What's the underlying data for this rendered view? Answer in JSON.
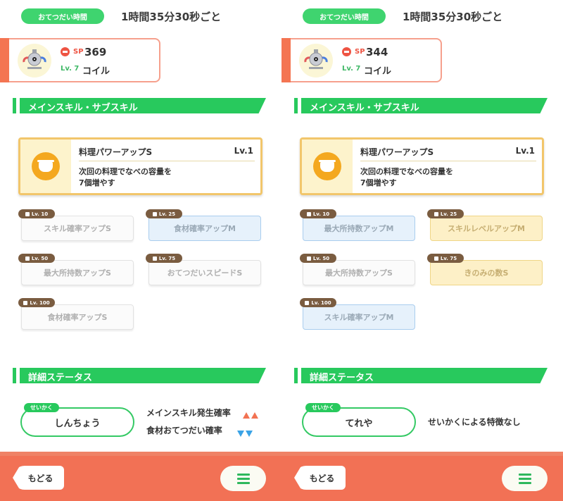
{
  "colors": {
    "accent_green": "#28c95d",
    "accent_orange": "#f27155",
    "sp_red": "#ee5443",
    "skill_gold": "#f2c66b",
    "increase_red": "#f27252",
    "decrease_blue": "#3aa3e6"
  },
  "panels": [
    {
      "help": {
        "label": "おてつだい時間",
        "time": "1時間35分30秒ごと"
      },
      "pokemon": {
        "sp_label": "SP",
        "sp_value": "369",
        "level": "Lv. 7",
        "name": "コイル",
        "icon": "magnemite-icon"
      },
      "skills_section": {
        "title": "メインスキル・サブスキル"
      },
      "main_skill": {
        "name": "料理パワーアップS",
        "level": "Lv.1",
        "desc_line1": "次回の料理でなべの容量を",
        "desc_line2": "7個増やす",
        "icon": "pot-icon"
      },
      "sub_skills": [
        {
          "lv": "Lv. 10",
          "name": "スキル確率アップS",
          "style": "gray"
        },
        {
          "lv": "Lv. 25",
          "name": "食材確率アップM",
          "style": "blue"
        },
        {
          "lv": "Lv. 50",
          "name": "最大所持数アップS",
          "style": "gray"
        },
        {
          "lv": "Lv. 75",
          "name": "おてつだいスピードS",
          "style": "gray"
        },
        {
          "lv": "Lv. 100",
          "name": "食材確率アップS",
          "style": "gray"
        }
      ],
      "status_section": {
        "title": "詳細ステータス"
      },
      "nature": {
        "label": "せいかく",
        "value": "しんちょう",
        "up": "メインスキル発生確率",
        "down": "食材おてつだい確率",
        "none_text": ""
      },
      "footer": {
        "back": "もどる"
      }
    },
    {
      "help": {
        "label": "おてつだい時間",
        "time": "1時間35分30秒ごと"
      },
      "pokemon": {
        "sp_label": "SP",
        "sp_value": "344",
        "level": "Lv. 7",
        "name": "コイル",
        "icon": "magnemite-icon"
      },
      "skills_section": {
        "title": "メインスキル・サブスキル"
      },
      "main_skill": {
        "name": "料理パワーアップS",
        "level": "Lv.1",
        "desc_line1": "次回の料理でなべの容量を",
        "desc_line2": "7個増やす",
        "icon": "pot-icon"
      },
      "sub_skills": [
        {
          "lv": "Lv. 10",
          "name": "最大所持数アップM",
          "style": "blue"
        },
        {
          "lv": "Lv. 25",
          "name": "スキルレベルアップM",
          "style": "gold"
        },
        {
          "lv": "Lv. 50",
          "name": "最大所持数アップS",
          "style": "gray"
        },
        {
          "lv": "Lv. 75",
          "name": "きのみの数S",
          "style": "gold"
        },
        {
          "lv": "Lv. 100",
          "name": "スキル確率アップM",
          "style": "blue"
        }
      ],
      "status_section": {
        "title": "詳細ステータス"
      },
      "nature": {
        "label": "せいかく",
        "value": "てれや",
        "up": "",
        "down": "",
        "none_text": "せいかくによる特徴なし"
      },
      "footer": {
        "back": "もどる"
      }
    }
  ]
}
